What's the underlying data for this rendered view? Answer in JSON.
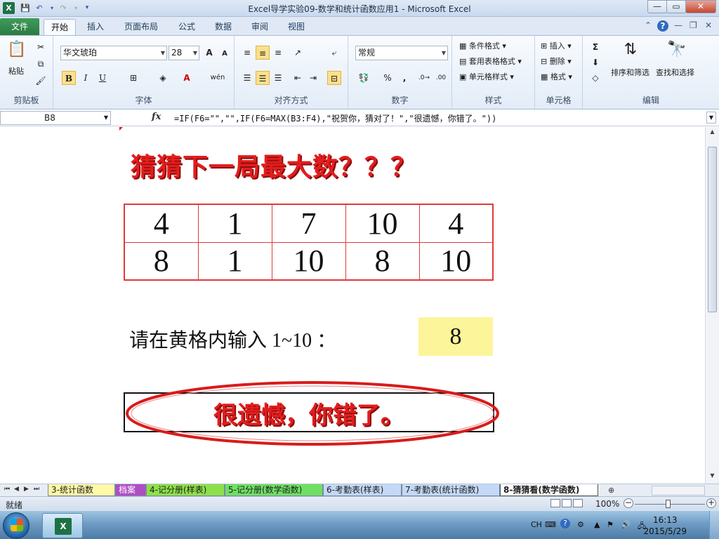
{
  "window": {
    "title": "Excel导学实验09-数学和统计函数应用1  -  Microsoft Excel",
    "app_icon": "X",
    "controls": {
      "min": "—",
      "max": "▭",
      "close": "✕"
    }
  },
  "ribbon": {
    "file_tab": "文件",
    "tabs": [
      "开始",
      "插入",
      "页面布局",
      "公式",
      "数据",
      "审阅",
      "视图"
    ],
    "active_tab": "开始",
    "groups": {
      "clipboard": {
        "label": "剪贴板",
        "paste": "粘贴"
      },
      "font": {
        "label": "字体",
        "font_name": "华文琥珀",
        "font_size": "28",
        "bold": "B",
        "italic": "I",
        "underline": "U",
        "grow": "A",
        "shrink": "A",
        "color": "A",
        "wen": "wén"
      },
      "alignment": {
        "label": "对齐方式"
      },
      "number": {
        "label": "数字",
        "format": "常规",
        "percent": "%",
        "comma": ",",
        "inc_dec": ".0→.00",
        "dec_dec": ".00→.0"
      },
      "styles": {
        "label": "样式",
        "conditional": "条件格式",
        "table": "套用表格格式",
        "cell": "单元格样式"
      },
      "cells": {
        "label": "单元格",
        "insert": "插入",
        "delete": "删除",
        "format": "格式"
      },
      "editing": {
        "label": "编辑",
        "sigma": "Σ",
        "sort": "排序和筛选",
        "find": "查找和选择"
      }
    }
  },
  "formula_bar": {
    "name_box": "B8",
    "fx": "fx",
    "formula": "=IF(F6=\"\",\"\",IF(F6=MAX(B3:F4),\"祝贺你，猜对了！\",\"很遗憾，你错了。\"))"
  },
  "sheet": {
    "headline": "猜猜下一局最大数？？？",
    "grid": [
      [
        "4",
        "1",
        "7",
        "10",
        "4"
      ],
      [
        "8",
        "1",
        "10",
        "8",
        "10"
      ]
    ],
    "prompt": "请在黄格内输入 1~10 ：",
    "input_value": "8",
    "result": "很遗憾，你错了。"
  },
  "sheet_tabs": {
    "tabs": [
      {
        "label": "3-统计函数",
        "color": "#fff9a8"
      },
      {
        "label": "档案",
        "color": "#b04cc4"
      },
      {
        "label": "4-记分册(样表)",
        "color": "#8ee04a"
      },
      {
        "label": "5-记分册(数学函数)",
        "color": "#6fe063"
      },
      {
        "label": "6-考勤表(样表)",
        "color": "#c3d9f5"
      },
      {
        "label": "7-考勤表(统计函数)",
        "color": "#c3d9f5"
      },
      {
        "label": "8-猜猜看(数学函数)",
        "color": "#ffffff"
      }
    ],
    "active": "8-猜猜看(数学函数)"
  },
  "status_bar": {
    "ready": "就绪",
    "zoom": "100%",
    "zoom_fraction": 0.5
  },
  "taskbar": {
    "lang": "CH",
    "time": "16:13",
    "date": "2015/5/29"
  },
  "colors": {
    "accent_red": "#e41d1d",
    "input_yellow": "#fdf59a",
    "excel_green": "#1e7145"
  }
}
